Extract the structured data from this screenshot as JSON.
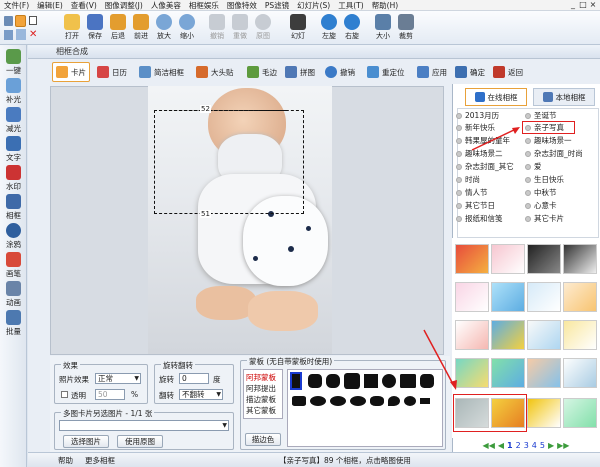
{
  "menu": [
    "文件(F)",
    "编辑(E)",
    "查看(V)",
    "图像调整(J)",
    "人像美容",
    "相框娱乐",
    "图像特效",
    "PS滤镜",
    "幻灯片(S)",
    "工具(T)",
    "帮助(H)"
  ],
  "window_controls": [
    "_",
    "□",
    "×"
  ],
  "toolbar": {
    "open": "打开",
    "save": "保存",
    "back": "后退",
    "forward": "前进",
    "zoom_in": "放大",
    "zoom_out": "缩小",
    "undo": "撤销",
    "redo": "重做",
    "original": "原图",
    "slideshow": "幻灯",
    "rotate_left": "左旋",
    "rotate_right": "右旋",
    "resize": "大小",
    "crop": "裁剪"
  },
  "sidebar": [
    "一键",
    "补光",
    "减光",
    "文字",
    "水印",
    "相框",
    "涂鸦",
    "画笔",
    "动画",
    "批量"
  ],
  "window_title": "相框合成",
  "tabs": [
    "卡片",
    "日历",
    "简洁相框",
    "大头贴",
    "毛边",
    "拼图",
    "撤销",
    "重定位",
    "应用",
    "确定",
    "返回"
  ],
  "canvas": {
    "dim_top": "52",
    "dim_mid": "51"
  },
  "right": {
    "tab_online": "在线相框",
    "tab_local": "本地相框",
    "categories": [
      "2013月历",
      "圣诞节",
      "新年快乐",
      "亲子写真",
      "韩果屋的童年",
      "趣味场景一",
      "趣味场景二",
      "杂志封面_时尚",
      "杂志封面_其它",
      "爱",
      "时尚",
      "生日快乐",
      "情人节",
      "中秋节",
      "其它节日",
      "心意卡",
      "报纸和信笺",
      "其它卡片"
    ],
    "selected": "亲子写真",
    "pager": {
      "prev2": "◀◀",
      "prev": "◀",
      "pages": [
        "1",
        "2",
        "3",
        "4",
        "5"
      ],
      "current": "1",
      "next": "▶",
      "next2": "▶▶"
    }
  },
  "effects": {
    "title": "效果",
    "photo_effect_label": "照片效果",
    "photo_effect_value": "正常",
    "transparent_label": "透明",
    "transparent_value": "50",
    "percent": "%"
  },
  "rotate": {
    "title": "旋转翻转",
    "rotate_label": "旋转",
    "rotate_value": "0",
    "degree": "度",
    "flip_label": "翻转",
    "flip_value": "不翻转"
  },
  "multi": {
    "title": "多图卡片另选图片 - 1/1 张",
    "select_btn": "选择图片",
    "use_original_btn": "使用原图"
  },
  "mask": {
    "title": "蒙板 (无自带蒙板时使用)",
    "items": [
      "阿邦蒙板",
      "阿邦提出",
      "描边蒙板",
      "其它蒙板"
    ],
    "color_btn": "描边色"
  },
  "status": {
    "help": "帮助",
    "more": "更多相框",
    "info": "【亲子写真】89 个相框，点击略图使用"
  },
  "colors": {
    "accent": "#e8a13a",
    "highlight": "#e02020",
    "link": "#1a3bd0"
  }
}
